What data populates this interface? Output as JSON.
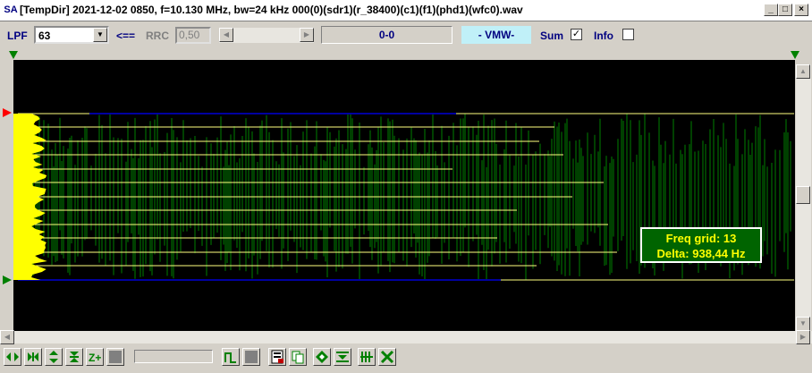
{
  "window": {
    "app_icon": "SA",
    "title": "[TempDir] 2021-12-02 0850, f=10.130 MHz, bw=24 kHz 000(0)(sdr1)(r_38400)(c1)(f1)(phd1)(wfc0).wav",
    "minimize": "_",
    "maximize": "□",
    "close": "×"
  },
  "toolbar": {
    "lpf_label": "LPF",
    "lpf_value": "63",
    "arrow_label": "<==",
    "rrc_label": "RRC",
    "rrc_value": "0,50",
    "range_text": "0-0",
    "mode_text": "- VMW-",
    "sum_label": "Sum",
    "sum_checked": "✓",
    "info_label": "Info",
    "info_checked": ""
  },
  "tooltip": {
    "line1": "Freq grid: 13",
    "line2": "Delta: 938,44 Hz"
  },
  "colors": {
    "plot_bg": "#000000",
    "grid_lines": "#ffff80",
    "signal": "#008000",
    "envelope": "#ffff00",
    "baseline": "#0000a0",
    "marker": "#ff0000",
    "triangle": "#008000"
  }
}
